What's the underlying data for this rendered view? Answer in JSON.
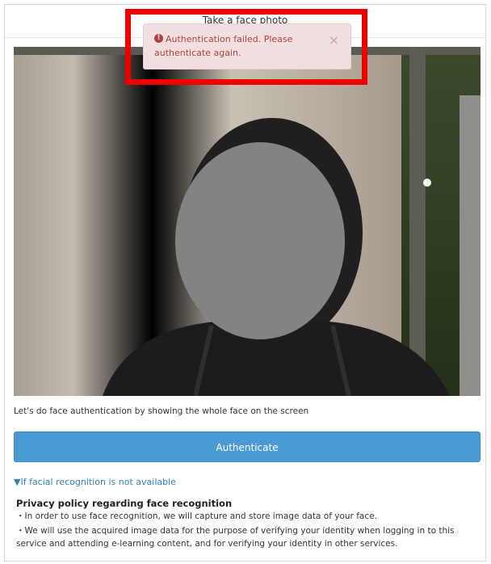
{
  "modal": {
    "title": "Take a face photo"
  },
  "alert": {
    "message": "Authentication failed. Please authenticate again.",
    "close_symbol": "×",
    "icon": "exclamation-circle-icon"
  },
  "instruction": "Let's do face authentication by showing the whole face on the screen",
  "authenticate_button": "Authenticate",
  "alternative_link": "▼If facial recognition is not available",
  "privacy": {
    "title": "Privacy policy regarding face recognition",
    "items": [
      "・In order to use face recognition, we will capture and store image data of your face.",
      "・We will use the acquired image data for the purpose of verifying your identity when logging in to this service and attending e-learning content, and for verifying your identity in other services."
    ]
  },
  "colors": {
    "primary": "#4a9ad4",
    "alert_bg": "#f2dede",
    "alert_text": "#a94442",
    "highlight": "#ee0000",
    "link": "#2f7fba"
  }
}
